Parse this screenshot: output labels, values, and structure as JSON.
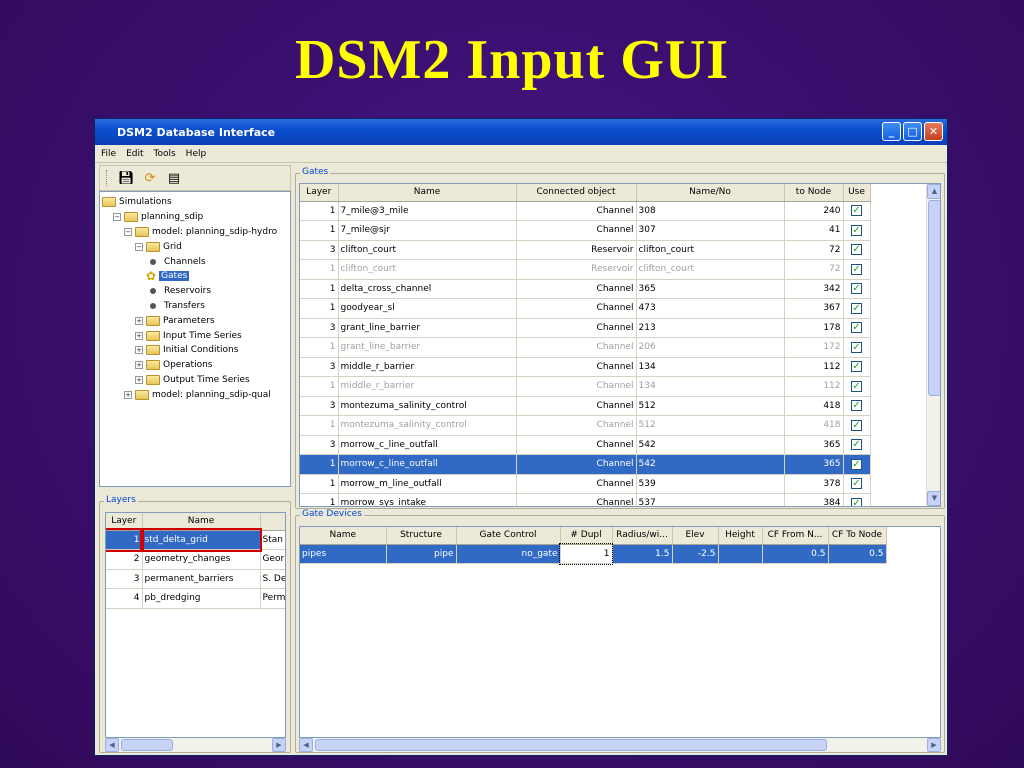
{
  "slide_title": "DSM2 Input GUI",
  "window": {
    "title": "DSM2 Database Interface"
  },
  "menu": [
    "File",
    "Edit",
    "Tools",
    "Help"
  ],
  "toolbar": {
    "icons": [
      "save-icon",
      "sync-icon",
      "copy-icon"
    ]
  },
  "tree": [
    {
      "label": "Simulations",
      "level": 0,
      "type": "folder",
      "expander": ""
    },
    {
      "label": "planning_sdip",
      "level": 1,
      "type": "folder",
      "expander": "−"
    },
    {
      "label": "model: planning_sdip-hydro",
      "level": 2,
      "type": "folder",
      "expander": "−"
    },
    {
      "label": "Grid",
      "level": 3,
      "type": "folder",
      "expander": "−"
    },
    {
      "label": "Channels",
      "level": 4,
      "type": "leaf"
    },
    {
      "label": "Gates",
      "level": 4,
      "type": "leaf-selected"
    },
    {
      "label": "Reservoirs",
      "level": 4,
      "type": "leaf"
    },
    {
      "label": "Transfers",
      "level": 4,
      "type": "leaf"
    },
    {
      "label": "Parameters",
      "level": 3,
      "type": "folder",
      "expander": "+"
    },
    {
      "label": "Input Time Series",
      "level": 3,
      "type": "folder",
      "expander": "+"
    },
    {
      "label": "Initial Conditions",
      "level": 3,
      "type": "folder",
      "expander": "+"
    },
    {
      "label": "Operations",
      "level": 3,
      "type": "folder",
      "expander": "+"
    },
    {
      "label": "Output Time Series",
      "level": 3,
      "type": "folder",
      "expander": "+"
    },
    {
      "label": "model: planning_sdip-qual",
      "level": 2,
      "type": "folder",
      "expander": "+"
    }
  ],
  "layers": {
    "title": "Layers",
    "columns": [
      "Layer",
      "Name",
      ""
    ],
    "rows": [
      {
        "layer": "1",
        "name": "std_delta_grid",
        "extra": "Stan",
        "selected": true
      },
      {
        "layer": "2",
        "name": "geometry_changes",
        "extra": "Geor",
        "selected": false
      },
      {
        "layer": "3",
        "name": "permanent_barriers",
        "extra": "S. De",
        "selected": false
      },
      {
        "layer": "4",
        "name": "pb_dredging",
        "extra": "Perm",
        "selected": false
      }
    ]
  },
  "gates": {
    "title": "Gates",
    "columns": [
      "Layer",
      "Name",
      "Connected object",
      "Name/No",
      "to Node",
      "Use"
    ],
    "rows": [
      {
        "layer": "1",
        "name": "7_mile@3_mile",
        "obj": "Channel",
        "nameno": "308",
        "node": "240",
        "state": ""
      },
      {
        "layer": "1",
        "name": "7_mile@sjr",
        "obj": "Channel",
        "nameno": "307",
        "node": "41",
        "state": ""
      },
      {
        "layer": "3",
        "name": "clifton_court",
        "obj": "Reservoir",
        "nameno": "clifton_court",
        "node": "72",
        "state": ""
      },
      {
        "layer": "1",
        "name": "clifton_court",
        "obj": "Reservoir",
        "nameno": "clifton_court",
        "node": "72",
        "state": "dim"
      },
      {
        "layer": "1",
        "name": "delta_cross_channel",
        "obj": "Channel",
        "nameno": "365",
        "node": "342",
        "state": ""
      },
      {
        "layer": "1",
        "name": "goodyear_sl",
        "obj": "Channel",
        "nameno": "473",
        "node": "367",
        "state": ""
      },
      {
        "layer": "3",
        "name": "grant_line_barrier",
        "obj": "Channel",
        "nameno": "213",
        "node": "178",
        "state": ""
      },
      {
        "layer": "1",
        "name": "grant_line_barrier",
        "obj": "Channel",
        "nameno": "206",
        "node": "172",
        "state": "dim"
      },
      {
        "layer": "3",
        "name": "middle_r_barrier",
        "obj": "Channel",
        "nameno": "134",
        "node": "112",
        "state": ""
      },
      {
        "layer": "1",
        "name": "middle_r_barrier",
        "obj": "Channel",
        "nameno": "134",
        "node": "112",
        "state": "dim"
      },
      {
        "layer": "3",
        "name": "montezuma_salinity_control",
        "obj": "Channel",
        "nameno": "512",
        "node": "418",
        "state": ""
      },
      {
        "layer": "1",
        "name": "montezuma_salinity_control",
        "obj": "Channel",
        "nameno": "512",
        "node": "418",
        "state": "dim"
      },
      {
        "layer": "3",
        "name": "morrow_c_line_outfall",
        "obj": "Channel",
        "nameno": "542",
        "node": "365",
        "state": ""
      },
      {
        "layer": "1",
        "name": "morrow_c_line_outfall",
        "obj": "Channel",
        "nameno": "542",
        "node": "365",
        "state": "sel"
      },
      {
        "layer": "1",
        "name": "morrow_m_line_outfall",
        "obj": "Channel",
        "nameno": "539",
        "node": "378",
        "state": ""
      },
      {
        "layer": "1",
        "name": "morrow_sys_intake",
        "obj": "Channel",
        "nameno": "537",
        "node": "384",
        "state": ""
      }
    ]
  },
  "devices": {
    "title": "Gate Devices",
    "columns": [
      "Name",
      "Structure",
      "Gate Control",
      "# Dupl",
      "Radius/wi...",
      "Elev",
      "Height",
      "CF From N...",
      "CF To Node"
    ],
    "rows": [
      {
        "name": "pipes",
        "structure": "pipe",
        "control": "no_gate",
        "dupl": "1",
        "radius": "1.5",
        "elev": "-2.5",
        "height": "",
        "cffrom": "0.5",
        "cfto": "0.5"
      }
    ]
  },
  "colors": {
    "selection": "#316ac5",
    "title_text": "#ffff00",
    "group_title": "#0046d5"
  }
}
